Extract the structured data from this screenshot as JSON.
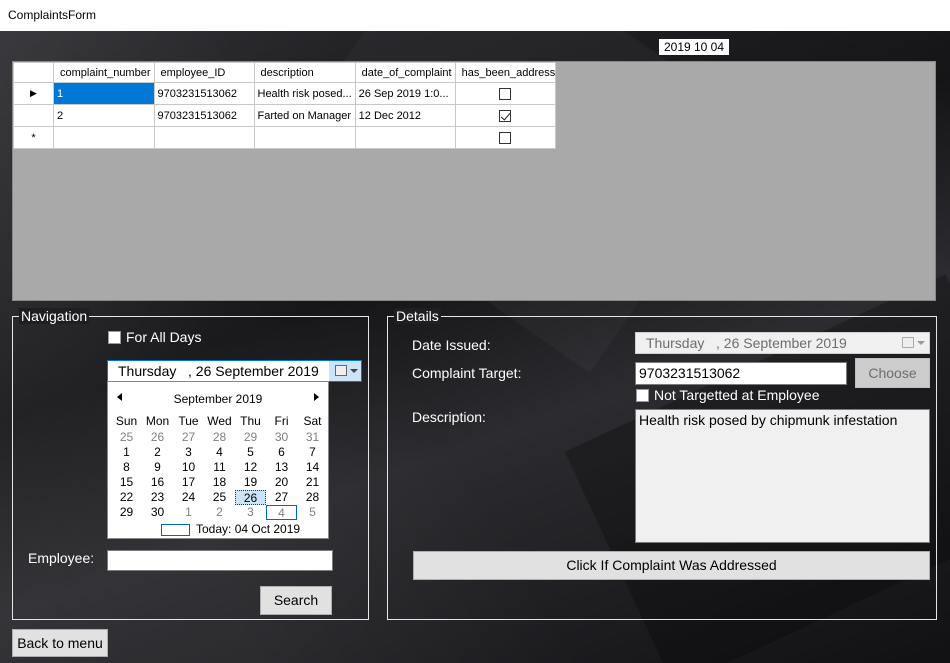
{
  "window": {
    "title": "ComplaintsForm"
  },
  "top_date": "2019 10 04",
  "grid": {
    "columns": [
      "complaint_number",
      "employee_ID",
      "description",
      "date_of_complaint",
      "has_been_addresse"
    ],
    "rows": [
      {
        "indicator": "▶",
        "complaint_number": "1",
        "employee_ID": "9703231513062",
        "description": "Health risk posed...",
        "date_of_complaint": "26 Sep 2019 1:0...",
        "has_been_addressed": false
      },
      {
        "indicator": "",
        "complaint_number": "2",
        "employee_ID": "9703231513062",
        "description": "Farted on Manager",
        "date_of_complaint": "12 Dec 2012",
        "has_been_addressed": true
      },
      {
        "indicator": "*",
        "complaint_number": "",
        "employee_ID": "",
        "description": "",
        "date_of_complaint": "",
        "has_been_addressed": false
      }
    ]
  },
  "navigation": {
    "title": "Navigation",
    "for_all_days_label": "For All Days",
    "for_all_days_checked": false,
    "date_picker_value": "Thursday   , 26 September 2019",
    "calendar": {
      "month_label": "September 2019",
      "weekdays": [
        "Sun",
        "Mon",
        "Tue",
        "Wed",
        "Thu",
        "Fri",
        "Sat"
      ],
      "weeks": [
        [
          "25",
          "26",
          "27",
          "28",
          "29",
          "30",
          "31"
        ],
        [
          "1",
          "2",
          "3",
          "4",
          "5",
          "6",
          "7"
        ],
        [
          "8",
          "9",
          "10",
          "11",
          "12",
          "13",
          "14"
        ],
        [
          "15",
          "16",
          "17",
          "18",
          "19",
          "20",
          "21"
        ],
        [
          "22",
          "23",
          "24",
          "25",
          "26",
          "27",
          "28"
        ],
        [
          "29",
          "30",
          "1",
          "2",
          "3",
          "4",
          "5"
        ]
      ],
      "selected_day": "26",
      "today_label": "Today: 04 Oct 2019"
    },
    "employee_label": "Employee:",
    "employee_value": "",
    "search_label": "Search"
  },
  "details": {
    "title": "Details",
    "date_issued_label": "Date Issued:",
    "date_issued_value": "Thursday   , 26 September 2019",
    "complaint_target_label": "Complaint Target:",
    "complaint_target_value": "9703231513062",
    "choose_label": "Choose",
    "not_targetted_label": "Not Targetted at Employee",
    "not_targetted_checked": false,
    "description_label": "Description:",
    "description_value": "Health risk posed by chipmunk infestation",
    "addressed_button_label": "Click If Complaint Was Addressed"
  },
  "back_label": "Back to menu"
}
